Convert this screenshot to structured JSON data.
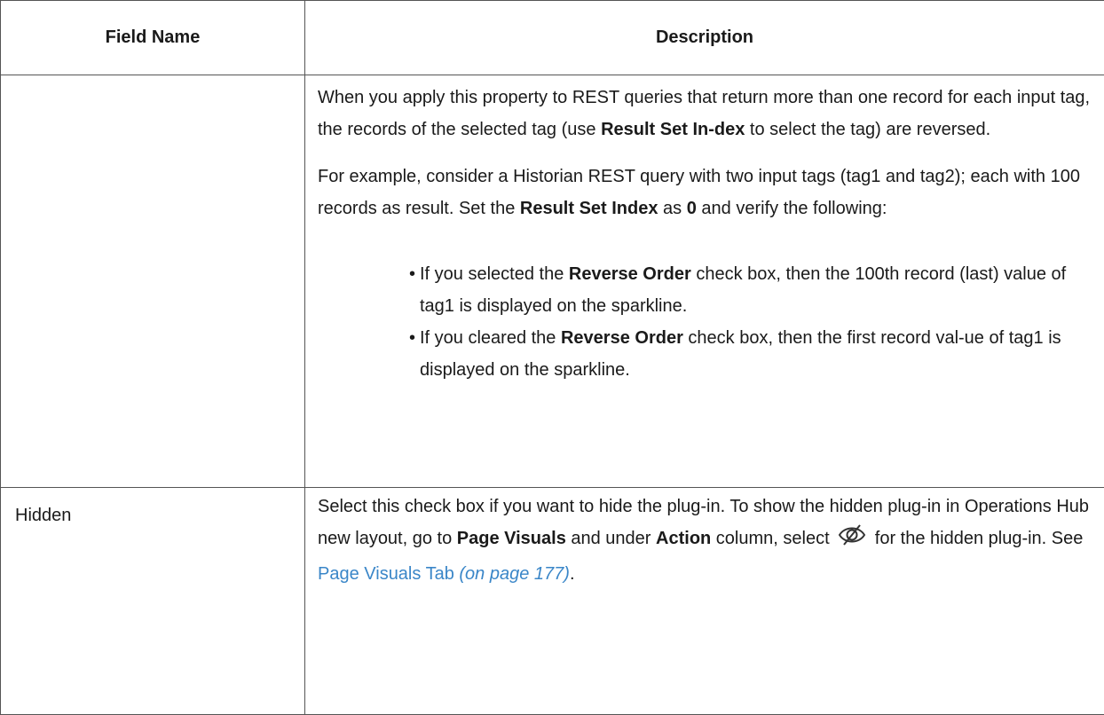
{
  "header": {
    "field_name": "Field Name",
    "description": "Description"
  },
  "row_reverse": {
    "field_name": "",
    "p1": {
      "t1": "When you apply this property to REST queries that return more than one record for each input tag, the records of the selected tag (use ",
      "b1": "Result Set In-dex",
      "t2": " to select the tag) are reversed."
    },
    "p2": {
      "t1": "For example, consider a Historian REST query with two input tags (tag1 and tag2); each with 100 records as result. Set the ",
      "b1": "Result Set Index",
      "t2": " as ",
      "b2": "0",
      "t3": " and verify the following:"
    },
    "bullets": [
      {
        "t1": "If you selected the ",
        "b1": "Reverse Order",
        "t2": " check box, then the 100th record (last) value of tag1 is displayed on the sparkline."
      },
      {
        "t1": "If you cleared the ",
        "b1": "Reverse Order",
        "t2": " check box, then the first record val-ue of tag1 is displayed on the sparkline."
      }
    ]
  },
  "row_hidden": {
    "field_name": "Hidden",
    "t1": "Select this check box if you want to hide the plug-in. To show the hidden plug-in in Operations Hub new layout, go to ",
    "b1": "Page Visuals",
    "t2": " and under ",
    "b2": "Action",
    "t3": " column, select ",
    "icon": "eye-slash-icon",
    "t4": " for the hidden plug-in. See ",
    "link_text": "Page Visuals Tab",
    "link_page": "(on page 177)",
    "t5": "."
  },
  "colors": {
    "link": "#3a86c8",
    "border": "#555555",
    "text": "#1a1a1a"
  }
}
